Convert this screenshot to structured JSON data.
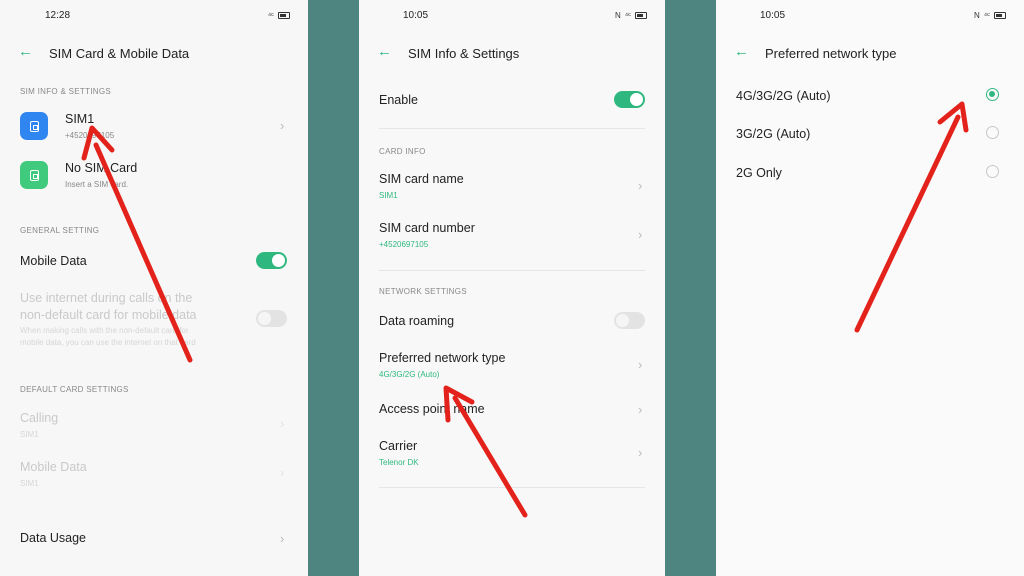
{
  "colors": {
    "accent": "#2eb87f",
    "band": "#4e8580",
    "arrow": "#e3231b",
    "sim1_icon": "#2f86f0",
    "sim2_icon": "#3fca7e"
  },
  "screen1": {
    "status": {
      "time": "12:28"
    },
    "title": "SIM Card & Mobile Data",
    "sim_section": "SIM INFO & SETTINGS",
    "sim1": {
      "label": "SIM1",
      "number": "+4520697105"
    },
    "sim2": {
      "label": "No SIM Card",
      "sub": "Insert a SIM card."
    },
    "general_section": "GENERAL SETTING",
    "mobile_data": {
      "label": "Mobile Data",
      "enabled": true
    },
    "use_internet": {
      "label_line1": "Use internet during calls on the",
      "label_line2": "non-default card for mobile data",
      "sub_line1": "When making calls with the non-default card for",
      "sub_line2": "mobile data, you can use the internet on that card",
      "enabled": false
    },
    "default_section": "DEFAULT CARD SETTINGS",
    "calling": {
      "label": "Calling",
      "sub": "SIM1"
    },
    "mobile_data_default": {
      "label": "Mobile Data",
      "sub": "SIM1"
    },
    "data_usage": {
      "label": "Data Usage"
    }
  },
  "screen2": {
    "status": {
      "time": "10:05"
    },
    "title": "SIM Info & Settings",
    "enable": {
      "label": "Enable",
      "enabled": true
    },
    "card_section": "CARD INFO",
    "card_name": {
      "label": "SIM card name",
      "value": "SIM1"
    },
    "card_number": {
      "label": "SIM card number",
      "value": "+4520697105"
    },
    "network_section": "NETWORK SETTINGS",
    "data_roaming": {
      "label": "Data roaming",
      "enabled": false
    },
    "preferred_network": {
      "label": "Preferred network type",
      "value": "4G/3G/2G (Auto)"
    },
    "apn": {
      "label": "Access point name"
    },
    "carrier": {
      "label": "Carrier",
      "value": "Telenor DK"
    }
  },
  "screen3": {
    "status": {
      "time": "10:05"
    },
    "title": "Preferred network type",
    "options": [
      {
        "label": "4G/3G/2G (Auto)",
        "selected": true
      },
      {
        "label": "3G/2G (Auto)",
        "selected": false
      },
      {
        "label": "2G Only",
        "selected": false
      }
    ]
  }
}
